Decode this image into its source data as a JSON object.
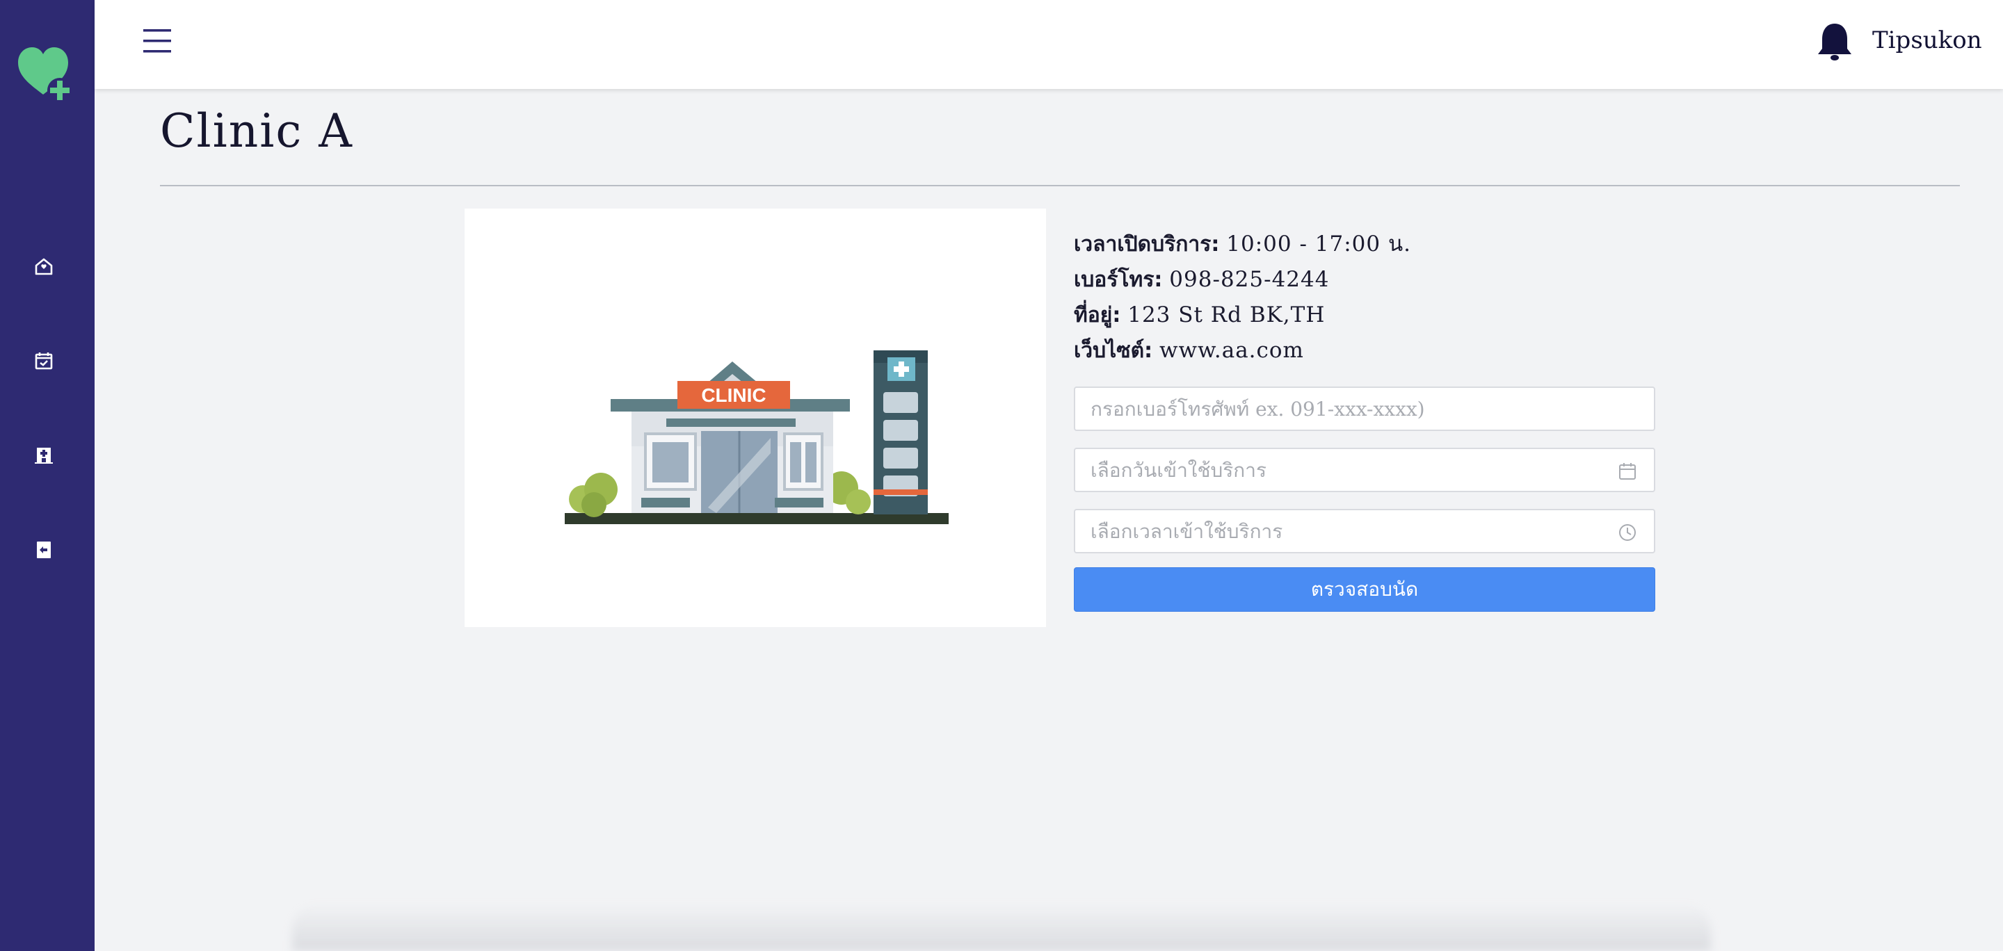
{
  "app": {
    "brand_color": "#2e2a72",
    "accent_color": "#4a8cf3",
    "logo_icon": "heart-plus-icon"
  },
  "sidebar": {
    "items": [
      {
        "icon": "home-icon"
      },
      {
        "icon": "calendar-check-icon"
      },
      {
        "icon": "hospital-building-icon"
      },
      {
        "icon": "logout-icon"
      }
    ]
  },
  "header": {
    "menu_icon": "hamburger-menu-icon",
    "notification_icon": "bell-icon",
    "username": "Tipsukon"
  },
  "page": {
    "title": "Clinic  A"
  },
  "clinic": {
    "image_label": "CLINIC",
    "hours_label": "เวลาเปิดบริการ:",
    "hours_value": "10:00 - 17:00 น.",
    "phone_label": "เบอร์โทร:",
    "phone_value": "098-825-4244",
    "address_label": "ที่อยู่:",
    "address_value": "123 St Rd BK,TH",
    "website_label": "เว็บไซต์:",
    "website_value": "www.aa.com"
  },
  "form": {
    "phone_placeholder": "กรอกเบอร์โทรศัพท์ ex. 091-xxx-xxxx)",
    "date_placeholder": "เลือกวันเข้าใช้บริการ",
    "time_placeholder": "เลือกเวลาเข้าใช้บริการ",
    "submit_label": "ตรวจสอบนัด"
  }
}
